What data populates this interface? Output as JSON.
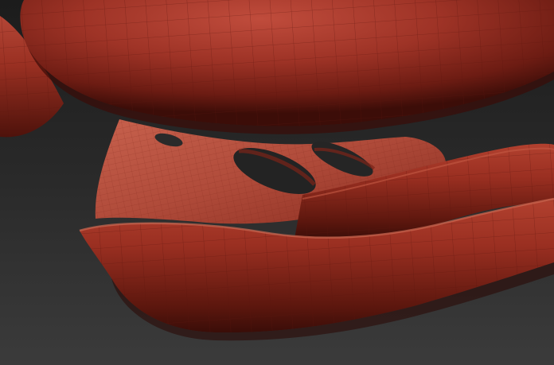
{
  "viewport": {
    "description_visible_text": [],
    "colors": {
      "background_top": "#1f1f1f",
      "background_bottom": "#3a3a3a",
      "clay_light": "#b8483a",
      "clay_mid": "#8e2a1f",
      "clay_dark": "#4a120c",
      "wire": "#6a1a12"
    }
  }
}
